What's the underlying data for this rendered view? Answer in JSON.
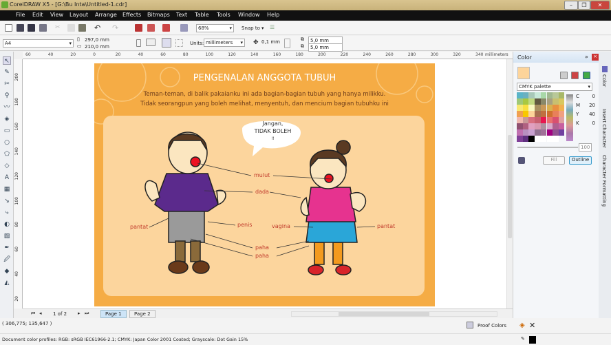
{
  "window": {
    "title": "CorelDRAW X5 - [G:\\Bu Inta\\Untitled-1.cdr]",
    "minimize": "–",
    "restore": "❐",
    "close": "✕"
  },
  "menu": [
    "File",
    "Edit",
    "View",
    "Layout",
    "Arrange",
    "Effects",
    "Bitmaps",
    "Text",
    "Table",
    "Tools",
    "Window",
    "Help"
  ],
  "toolbar": {
    "zoom": "68%",
    "snap_to": "Snap to"
  },
  "property_bar": {
    "page_size": "A4",
    "width": "297,0 mm",
    "height": "210,0 mm",
    "units_label": "Units:",
    "units": "millimeters",
    "nudge": "0,1 mm",
    "dup_x": "5,0 mm",
    "dup_y": "5,0 mm"
  },
  "ruler": {
    "h_labels": [
      "60",
      "40",
      "20",
      "0",
      "20",
      "40",
      "60",
      "80",
      "100",
      "120",
      "140",
      "160",
      "180",
      "200",
      "220",
      "240",
      "260",
      "280",
      "300",
      "320",
      "340"
    ],
    "unit": "millimeters",
    "v_labels": [
      "200",
      "180",
      "160",
      "140",
      "120",
      "100",
      "80",
      "60",
      "40",
      "20"
    ]
  },
  "document": {
    "title": "PENGENALAN ANGGOTA TUBUH",
    "line1": "Teman-teman, di balik pakaianku ini ada bagian-bagian tubuh yang hanya milikku.",
    "line2": "Tidak seorangpun yang boleh melihat, menyentuh, dan mencium bagian tubuhku ini",
    "bubble1": "Jangan,",
    "bubble2": "TIDAK BOLEH",
    "bubble3": "!!",
    "labels": {
      "mulut": "mulut",
      "dada": "dada",
      "pantat_l": "pantat",
      "penis": "penis",
      "paha1": "paha",
      "paha2": "paha",
      "vagina": "vagina",
      "pantat_r": "pantat"
    },
    "colors": {
      "background": "#f5ac45",
      "panel": "#fcd59d",
      "boy_shirt": "#5b2a8c",
      "girl_shirt": "#e6338f",
      "girl_skirt": "#2aa6d8"
    }
  },
  "pages": {
    "counter": "1 of 2",
    "tabs": [
      "Page 1",
      "Page 2"
    ]
  },
  "docker": {
    "title": "Color",
    "palette": "CMYK palette",
    "cmyk": [
      {
        "k": "C",
        "v": "0"
      },
      {
        "k": "M",
        "v": "20"
      },
      {
        "k": "Y",
        "v": "40"
      },
      {
        "k": "K",
        "v": "0"
      }
    ],
    "tint": "100",
    "fill": "Fill",
    "outline": "Outline",
    "current_color": "#fdd49a"
  },
  "side_tabs": [
    "Color",
    "Insert Character",
    "Character Formatting"
  ],
  "status": {
    "coords": "( 306,775; 135,647 )",
    "proof_colors": "Proof Colors",
    "profiles": "Document color profiles: RGB: sRGB IEC61966-2.1; CMYK: Japan Color 2001 Coated; Grayscale: Dot Gain 15%"
  }
}
